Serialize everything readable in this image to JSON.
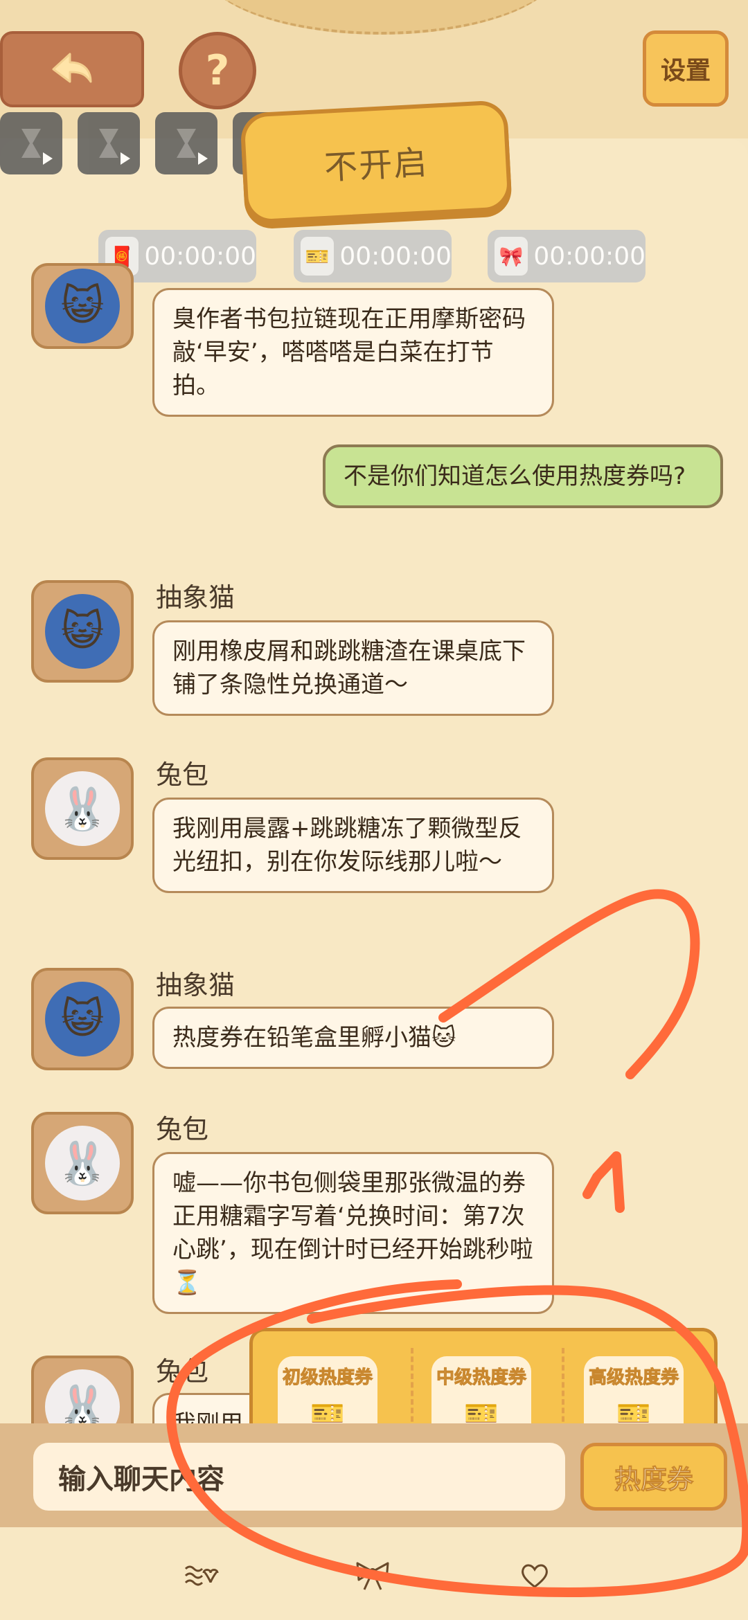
{
  "header": {
    "help_label": "?",
    "settings_label": "设置",
    "main_button_label": "不开启"
  },
  "timers": [
    {
      "icon": "🧧",
      "time": "00:00:00"
    },
    {
      "icon": "🎫",
      "time": "00:00:00"
    },
    {
      "icon": "🎀",
      "time": "00:00:00"
    }
  ],
  "messages": [
    {
      "sender": "",
      "text": "臭作者书包拉链现在正用摩斯密码敲‘早安’，嗒嗒嗒是白菜在打节拍。"
    },
    {
      "sender": "",
      "text": "不是你们知道怎么使用热度券吗?",
      "mine": true
    },
    {
      "sender": "抽象猫",
      "text": "刚用橡皮屑和跳跳糖渣在课桌底下铺了条隐性兑换通道～"
    },
    {
      "sender": "兔包",
      "text": "我刚用晨露+跳跳糖冻了颗微型反光纽扣，别在你发际线那儿啦～"
    },
    {
      "sender": "抽象猫",
      "text": "热度券在铅笔盒里孵小猫🐱"
    },
    {
      "sender": "兔包",
      "text": "嘘——你书包侧袋里那张微温的券正用糖霜字写着‘兑换时间：第7次心跳’，现在倒计时已经开始跳秒啦⏳"
    },
    {
      "sender": "兔包",
      "text": "我刚用"
    }
  ],
  "coupons": [
    {
      "label": "初级热度券",
      "icon": "🎫"
    },
    {
      "label": "中级热度券",
      "icon": "🎫"
    },
    {
      "label": "高级热度券",
      "icon": "🎫"
    }
  ],
  "input": {
    "placeholder": "输入聊天内容",
    "send_label": "热度券"
  },
  "bottom_nav": [
    {
      "icon": "wave-heart-icon"
    },
    {
      "icon": "bow-icon"
    },
    {
      "icon": "heart-icon"
    }
  ],
  "colors": {
    "background": "#f7e7c3",
    "bubble": "#fff6e6",
    "mine_bubble": "#c8e393",
    "accent_yellow": "#f6c24e",
    "brown": "#c27a52",
    "scribble": "#ff6a3a"
  }
}
